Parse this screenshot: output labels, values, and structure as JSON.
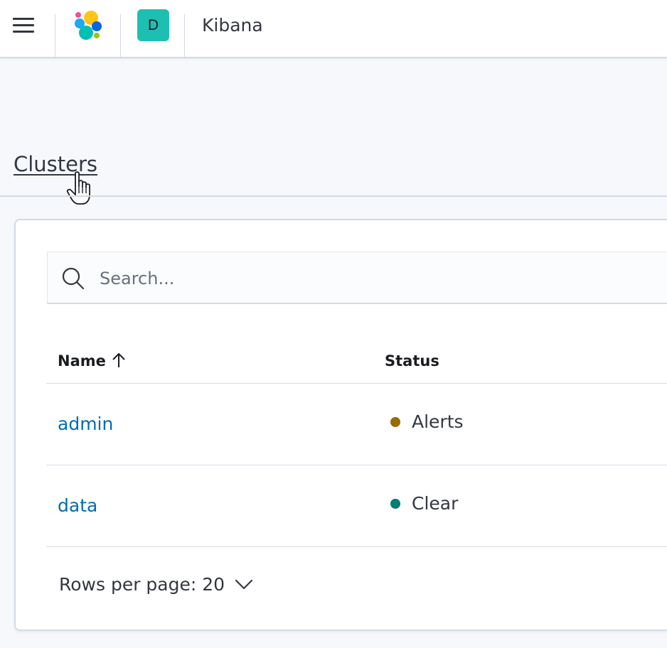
{
  "header": {
    "app_title": "Kibana",
    "space_initial": "D",
    "space_color": "#1ebfb3"
  },
  "breadcrumb": {
    "label": "Clusters"
  },
  "search": {
    "placeholder": "Search...",
    "value": ""
  },
  "table": {
    "columns": [
      {
        "label": "Name",
        "sort": "ascending"
      },
      {
        "label": "Status"
      }
    ],
    "rows": [
      {
        "name": "admin",
        "status": "Alerts",
        "status_color": "#9b6900"
      },
      {
        "name": "data",
        "status": "Clear",
        "status_color": "#017d73"
      }
    ]
  },
  "pagination": {
    "rows_per_page_label": "Rows per page: 20"
  },
  "colors": {
    "link": "#006bb8",
    "border": "#d3dae6",
    "background": "#f7f8fc"
  }
}
